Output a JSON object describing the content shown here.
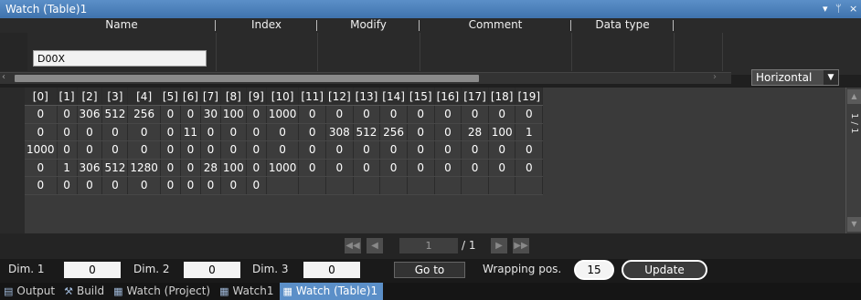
{
  "window": {
    "title": "Watch (Table)1",
    "pin_glyph": "▾ ᛘ ×"
  },
  "columns": {
    "name": "Name",
    "index": "Index",
    "modify": "Modify",
    "comment": "Comment",
    "data_type": "Data type"
  },
  "name_value": "D00X",
  "layout_select": {
    "value": "Horizontal"
  },
  "grid": {
    "headers": [
      "[0]",
      "[1]",
      "[2]",
      "[3]",
      "[4]",
      "[5]",
      "[6]",
      "[7]",
      "[8]",
      "[9]",
      "[10]",
      "[11]",
      "[12]",
      "[13]",
      "[14]",
      "[15]",
      "[16]",
      "[17]",
      "[18]",
      "[19]"
    ],
    "rows": [
      [
        "0",
        "0",
        "306",
        "512",
        "256",
        "0",
        "0",
        "30",
        "100",
        "0",
        "1000",
        "0",
        "0",
        "0",
        "0",
        "0",
        "0",
        "0",
        "0",
        "0"
      ],
      [
        "0",
        "0",
        "0",
        "0",
        "0",
        "0",
        "11",
        "0",
        "0",
        "0",
        "0",
        "0",
        "308",
        "512",
        "256",
        "0",
        "0",
        "28",
        "100",
        "1"
      ],
      [
        "1000",
        "0",
        "0",
        "0",
        "0",
        "0",
        "0",
        "0",
        "0",
        "0",
        "0",
        "0",
        "0",
        "0",
        "0",
        "0",
        "0",
        "0",
        "0",
        "0"
      ],
      [
        "0",
        "1",
        "306",
        "512",
        "1280",
        "0",
        "0",
        "28",
        "100",
        "0",
        "1000",
        "0",
        "0",
        "0",
        "0",
        "0",
        "0",
        "0",
        "0",
        "0"
      ],
      [
        "0",
        "0",
        "0",
        "0",
        "0",
        "0",
        "0",
        "0",
        "0",
        "0",
        "",
        "",
        "",
        "",
        "",
        "",
        "",
        "",
        "",
        ""
      ]
    ]
  },
  "vertical_pager": {
    "text": "1 / 1"
  },
  "pager": {
    "current": "1",
    "total": "/ 1"
  },
  "dims": {
    "dim1_label": "Dim. 1",
    "dim1_value": "0",
    "dim2_label": "Dim. 2",
    "dim2_value": "0",
    "dim3_label": "Dim. 3",
    "dim3_value": "0"
  },
  "goto_label": "Go to",
  "wrapping": {
    "label": "Wrapping pos.",
    "value": "15"
  },
  "update_label": "Update",
  "tabs": [
    {
      "label": "Output",
      "icon": "output-icon"
    },
    {
      "label": "Build",
      "icon": "build-icon"
    },
    {
      "label": "Watch (Project)",
      "icon": "watch-icon"
    },
    {
      "label": "Watch1",
      "icon": "watch-icon"
    },
    {
      "label": "Watch (Table)1",
      "icon": "watch-icon",
      "active": true
    }
  ],
  "colors": {
    "accent": "#5b8fc8",
    "background": "#1f1f1f"
  }
}
